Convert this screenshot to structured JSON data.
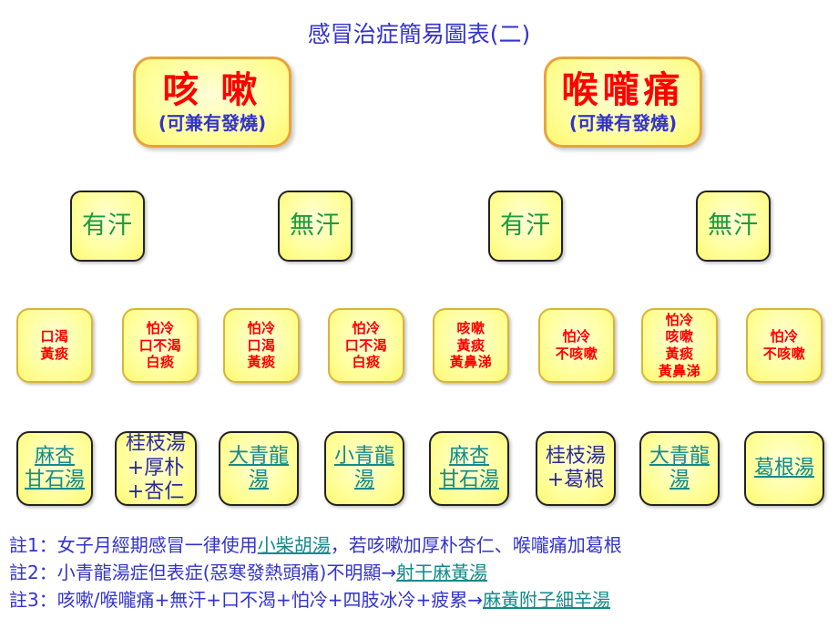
{
  "page": {
    "title": "感冒治症簡易圖表(二)",
    "title_color": "#3333cc",
    "background": "#ffffff"
  },
  "colors": {
    "card_fill": "#ffff9e",
    "symptom_text": "#ff0000",
    "sweat_text": "#1d9a3e",
    "link_text": "#128a8a",
    "plain_rx_text": "#2a2a9e",
    "note_text": "#3333cc",
    "head_border": "#e8a33d"
  },
  "headings": [
    {
      "main": "咳 嗽",
      "sub": "(可兼有發燒)"
    },
    {
      "main": "喉嚨痛",
      "sub": "(可兼有發燒)"
    }
  ],
  "sweat": [
    {
      "label": "有汗"
    },
    {
      "label": "無汗"
    },
    {
      "label": "有汗"
    },
    {
      "label": "無汗"
    }
  ],
  "symptoms": [
    {
      "lines": "口渴\n黃痰"
    },
    {
      "lines": "怕冷\n口不渴\n白痰"
    },
    {
      "lines": "怕冷\n口渴\n黃痰"
    },
    {
      "lines": "怕冷\n口不渴\n白痰"
    },
    {
      "lines": "咳嗽\n黃痰\n黃鼻涕"
    },
    {
      "lines": "怕冷\n不咳嗽"
    },
    {
      "lines": "怕冷\n咳嗽\n黃痰\n黃鼻涕"
    },
    {
      "lines": "怕冷\n不咳嗽"
    }
  ],
  "prescriptions": [
    {
      "lines": "麻杏\n甘石湯",
      "style": "link"
    },
    {
      "lines": "桂枝湯\n+厚朴\n+杏仁",
      "style": "plain"
    },
    {
      "lines": "大青龍\n湯",
      "style": "link"
    },
    {
      "lines": "小青龍\n湯",
      "style": "link"
    },
    {
      "lines": "麻杏\n甘石湯",
      "style": "link"
    },
    {
      "lines": "桂枝湯\n+葛根",
      "style": "plain"
    },
    {
      "lines": "大青龍\n湯",
      "style": "link"
    },
    {
      "lines": "葛根湯",
      "style": "link"
    }
  ],
  "notes": [
    {
      "prefix": "註1：女子月經期感冒一律使用",
      "link": "小柴胡湯",
      "suffix": "，若咳嗽加厚朴杏仁、喉嚨痛加葛根"
    },
    {
      "prefix": "註2：小青龍湯症但表症(惡寒發熱頭痛)不明顯→",
      "link": "射干麻黃湯",
      "suffix": ""
    },
    {
      "prefix": "註3：咳嗽/喉嚨痛+無汗+口不渴+怕冷+四肢冰冷+疲累→",
      "link": "麻黃附子細辛湯",
      "suffix": ""
    }
  ]
}
